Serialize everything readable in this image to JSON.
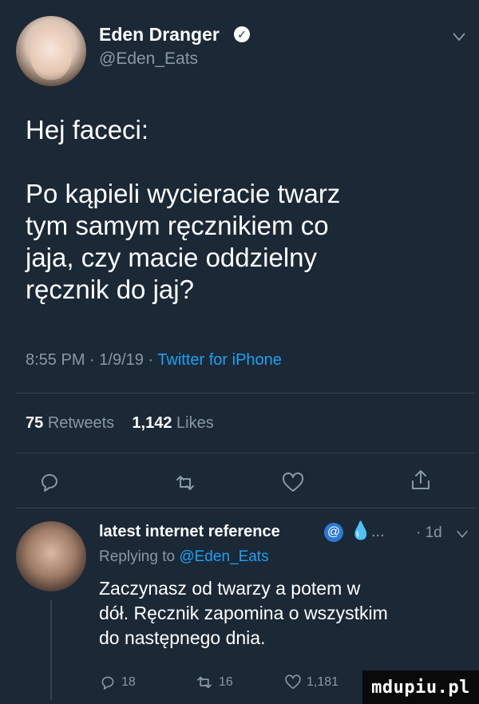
{
  "tweet": {
    "display_name": "Eden Dranger",
    "handle": "@Eden_Eats",
    "text": "Hej faceci:\n\nPo kąpieli wycieracie twarz\ntym samym ręcznikiem co\njaja, czy macie oddzielny\nręcznik do jaj?",
    "time": "8:55 PM",
    "date": "1/9/19",
    "source": "Twitter for iPhone",
    "retweets": "75",
    "retweets_label": "Retweets",
    "likes": "1,142",
    "likes_label": "Likes"
  },
  "reply": {
    "display_name": "latest internet reference",
    "ellipsis": "...",
    "time": "· 1d",
    "replying_prefix": "Replying to",
    "replying_to": "@Eden_Eats",
    "text": "Zaczynasz od twarzy a potem w\ndół. Ręcznik zapomina o wszystkim\ndo następnego dnia.",
    "replies": "18",
    "retweets": "16",
    "likes": "1,181"
  },
  "watermark": "mdupiu.pl",
  "colors": {
    "background": "#1b2836",
    "secondary_text": "#8899a6",
    "link": "#1da1f2",
    "divider": "#38444d"
  }
}
